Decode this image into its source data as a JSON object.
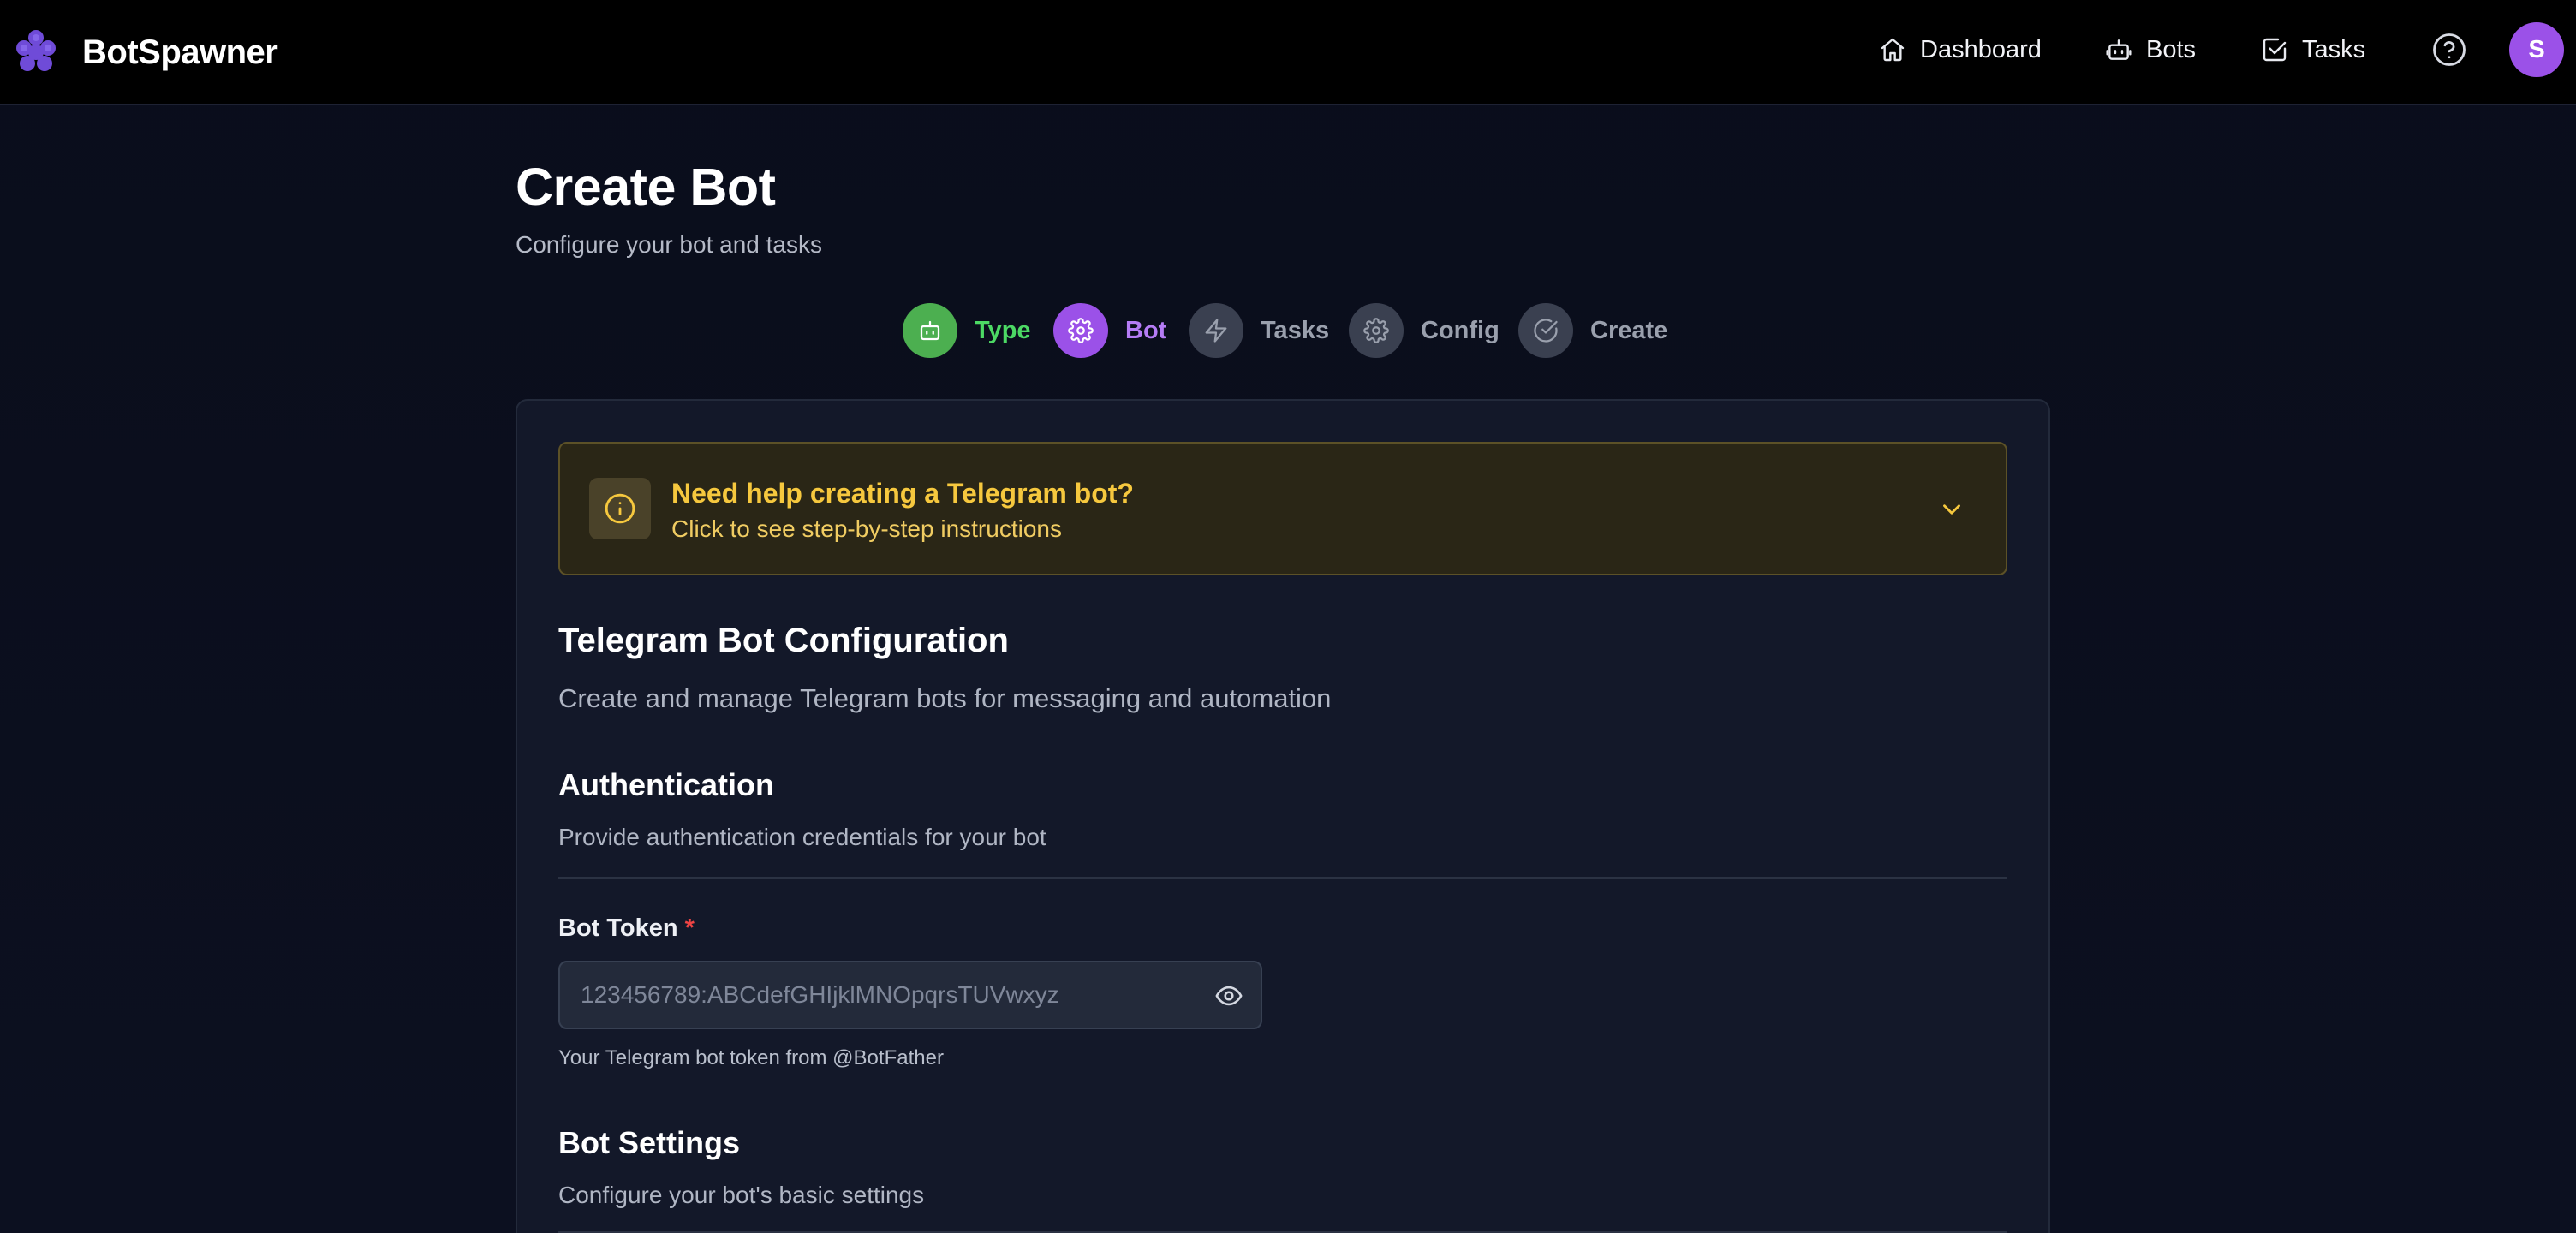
{
  "brand": {
    "name": "BotSpawner"
  },
  "nav": {
    "dashboard": "Dashboard",
    "bots": "Bots",
    "tasks": "Tasks",
    "help_icon": "help-circle-icon",
    "avatar_initial": "S"
  },
  "page": {
    "title": "Create Bot",
    "subtitle": "Configure your bot and tasks"
  },
  "stepper": {
    "steps": [
      {
        "label": "Type",
        "icon": "bot-icon",
        "state": "complete",
        "color": "#4caf50"
      },
      {
        "label": "Bot",
        "icon": "gear-icon",
        "state": "active",
        "color": "#9b51e8"
      },
      {
        "label": "Tasks",
        "icon": "lightning-icon",
        "state": "pending"
      },
      {
        "label": "Config",
        "icon": "gear-icon",
        "state": "pending"
      },
      {
        "label": "Create",
        "icon": "check-circle-icon",
        "state": "pending"
      }
    ]
  },
  "help_banner": {
    "title": "Need help creating a Telegram bot?",
    "subtitle": "Click to see step-by-step instructions"
  },
  "config": {
    "title": "Telegram Bot Configuration",
    "description": "Create and manage Telegram bots for messaging and automation"
  },
  "authentication": {
    "title": "Authentication",
    "description": "Provide authentication credentials for your bot",
    "token_label": "Bot Token",
    "required_mark": "*",
    "token_value": "",
    "token_placeholder": "123456789:ABCdefGHIjklMNOpqrsTUVwxyz",
    "token_help": "Your Telegram bot token from @BotFather"
  },
  "bot_settings": {
    "title": "Bot Settings",
    "description": "Configure your bot's basic settings"
  },
  "colors": {
    "accent_purple": "#9b51e8",
    "success_green": "#4caf50",
    "warning_yellow": "#f6c83e",
    "required_red": "#ef4444"
  }
}
